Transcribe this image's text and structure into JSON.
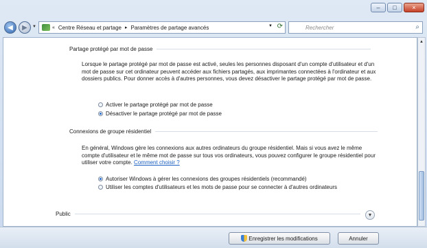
{
  "window": {
    "controls": {
      "minimize": "–",
      "maximize": "□",
      "close": "×"
    }
  },
  "navbar": {
    "breadcrumb_prefix": "«",
    "breadcrumb": [
      "Centre Réseau et partage",
      "Paramètres de partage avancés"
    ],
    "breadcrumb_separator": "▸",
    "search_placeholder": "Rechercher"
  },
  "sections": {
    "password": {
      "title": "Partage protégé par mot de passe",
      "text": "Lorsque le partage protégé par mot de passe est activé, seules les personnes disposant d'un compte d'utilisateur et d'un mot de passe sur cet ordinateur peuvent accéder aux fichiers partagés, aux imprimantes connectées à l'ordinateur et aux dossiers publics. Pour donner accès à d'autres personnes, vous devez désactiver le partage protégé par mot de passe.",
      "options": [
        {
          "label": "Activer le partage protégé par mot de passe",
          "selected": false
        },
        {
          "label": "Désactiver le partage protégé par mot de passe",
          "selected": true
        }
      ]
    },
    "homegroup": {
      "title": "Connexions de groupe résidentiel",
      "text": "En général, Windows gère les connexions aux autres ordinateurs du groupe résidentiel. Mais si vous avez le même compte d'utilisateur et le même mot de passe sur tous vos ordinateurs, vous pouvez configurer le groupe résidentiel pour utiliser votre compte.",
      "link": "Comment choisir ?",
      "options": [
        {
          "label": "Autoriser Windows à gérer les connexions des groupes résidentiels (recommandé)",
          "selected": true
        },
        {
          "label": "Utiliser les comptes d'utilisateurs et les mots de passe pour se connecter à d'autres ordinateurs",
          "selected": false
        }
      ]
    },
    "public": {
      "title": "Public"
    }
  },
  "buttons": {
    "save": "Enregistrer les modifications",
    "cancel": "Annuler"
  },
  "icons": {
    "back": "back-arrow-icon",
    "forward": "forward-arrow-icon",
    "network": "network-icon",
    "refresh": "refresh-icon",
    "search": "search-icon",
    "expand": "chevron-down-icon",
    "shield": "uac-shield-icon"
  },
  "colors": {
    "link": "#1a5fc1",
    "radio_selected": "#2a6fd0"
  }
}
